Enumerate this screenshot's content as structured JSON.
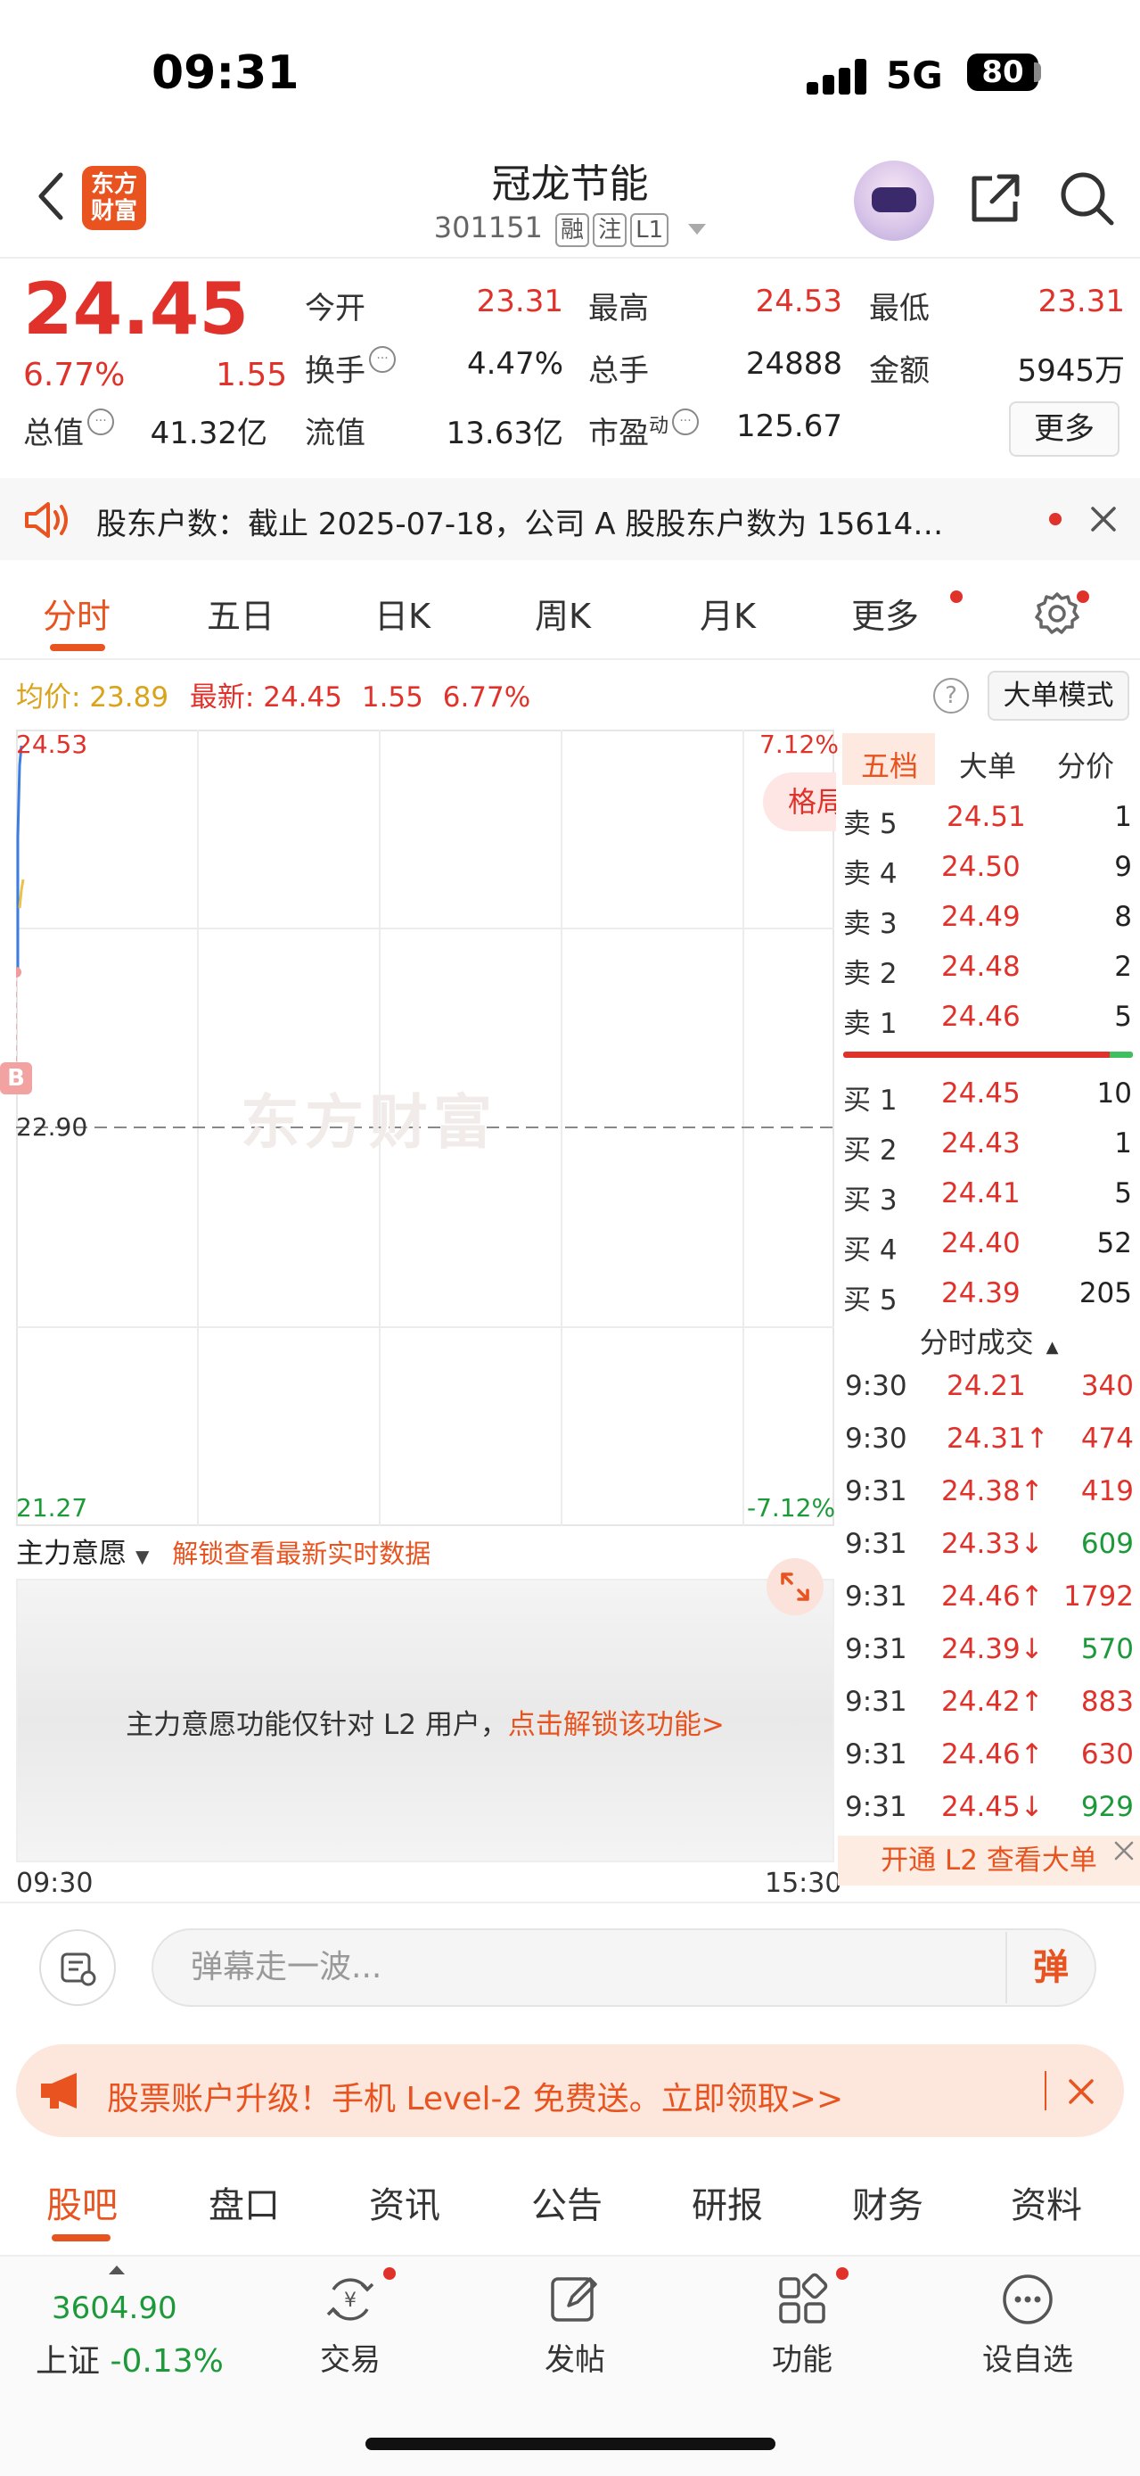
{
  "status_bar": {
    "time": "09:31",
    "network": "5G",
    "battery": "80"
  },
  "header": {
    "logo_line1": "东方",
    "logo_line2": "财富",
    "stock_name": "冠龙节能",
    "stock_code": "301151",
    "tags": [
      "融",
      "注",
      "L1"
    ]
  },
  "quote": {
    "price": "24.45",
    "change_pct": "6.77%",
    "change": "1.55",
    "fields": {
      "open_label": "今开",
      "open": "23.31",
      "high_label": "最高",
      "high": "24.53",
      "low_label": "最低",
      "low": "23.31",
      "turnover_label": "换手",
      "turnover": "4.47%",
      "volume_label": "总手",
      "volume": "24888",
      "amount_label": "金额",
      "amount": "5945万",
      "mktcap_label": "总值",
      "mktcap": "41.32亿",
      "float_label": "流值",
      "float_cap": "13.63亿",
      "pe_label": "市盈",
      "pe_sup": "动",
      "pe": "125.67"
    },
    "more_label": "更多"
  },
  "notice": {
    "text": "股东户数：截止 2025-07-18，公司 A 股股东户数为 15614…"
  },
  "chart_tabs": [
    "分时",
    "五日",
    "日K",
    "周K",
    "月K",
    "更多"
  ],
  "chart_header": {
    "avg_label": "均价:",
    "avg": "23.89",
    "latest_label": "最新:",
    "latest": "24.45",
    "change": "1.55",
    "change_pct": "6.77%",
    "big_order_mode": "大单模式"
  },
  "chart": {
    "y_top": "24.53",
    "y_mid": "22.90",
    "y_bottom": "21.27",
    "pct_top": "7.12%",
    "pct_bottom": "-7.12%",
    "watermark": "东方财富",
    "pattern_label": "格局",
    "b_badge": "B",
    "time_start": "09:30",
    "time_end": "15:30"
  },
  "main_intent": {
    "label": "主力意愿",
    "lock_link": "解锁查看最新实时数据",
    "panel_msg": "主力意愿功能仅针对 L2 用户，",
    "panel_link": "点击解锁该功能>"
  },
  "order_book": {
    "tabs": [
      "五档",
      "大单",
      "分价"
    ],
    "asks": [
      {
        "label": "卖 5",
        "price": "24.51",
        "vol": "1"
      },
      {
        "label": "卖 4",
        "price": "24.50",
        "vol": "9"
      },
      {
        "label": "卖 3",
        "price": "24.49",
        "vol": "8"
      },
      {
        "label": "卖 2",
        "price": "24.48",
        "vol": "2"
      },
      {
        "label": "卖 1",
        "price": "24.46",
        "vol": "5"
      }
    ],
    "bids": [
      {
        "label": "买 1",
        "price": "24.45",
        "vol": "10"
      },
      {
        "label": "买 2",
        "price": "24.43",
        "vol": "1"
      },
      {
        "label": "买 3",
        "price": "24.41",
        "vol": "5"
      },
      {
        "label": "买 4",
        "price": "24.40",
        "vol": "52"
      },
      {
        "label": "买 5",
        "price": "24.39",
        "vol": "205"
      }
    ],
    "trades_title": "分时成交",
    "trades": [
      {
        "time": "9:30",
        "price": "24.21",
        "vol": "340",
        "dir": "",
        "color": "red"
      },
      {
        "time": "9:30",
        "price": "24.31↑",
        "vol": "474",
        "dir": "up",
        "color": "red"
      },
      {
        "time": "9:31",
        "price": "24.38↑",
        "vol": "419",
        "dir": "up",
        "color": "red"
      },
      {
        "time": "9:31",
        "price": "24.33↓",
        "vol": "609",
        "dir": "down",
        "color": "green"
      },
      {
        "time": "9:31",
        "price": "24.46↑",
        "vol": "1792",
        "dir": "up",
        "color": "red"
      },
      {
        "time": "9:31",
        "price": "24.39↓",
        "vol": "570",
        "dir": "down",
        "color": "green"
      },
      {
        "time": "9:31",
        "price": "24.42↑",
        "vol": "883",
        "dir": "up",
        "color": "red"
      },
      {
        "time": "9:31",
        "price": "24.46↑",
        "vol": "630",
        "dir": "up",
        "color": "red"
      },
      {
        "time": "9:31",
        "price": "24.45↓",
        "vol": "929",
        "dir": "down",
        "color": "green"
      }
    ],
    "open_l2": "开通 L2 查看大单"
  },
  "danmaku": {
    "placeholder": "弹幕走一波...",
    "button": "弹"
  },
  "promo": {
    "text": "股票账户升级！手机 Level-2 免费送。立即领取>>"
  },
  "bottom_tabs": [
    "股吧",
    "盘口",
    "资讯",
    "公告",
    "研报",
    "财务",
    "资料"
  ],
  "bottom_nav": {
    "index_value": "3604.90",
    "index_name": "上证",
    "index_change": "-0.13%",
    "items": [
      "交易",
      "发帖",
      "功能",
      "设自选"
    ]
  },
  "colors": {
    "up": "#e0322b",
    "down": "#1c9a3a",
    "accent": "#e8531f"
  }
}
